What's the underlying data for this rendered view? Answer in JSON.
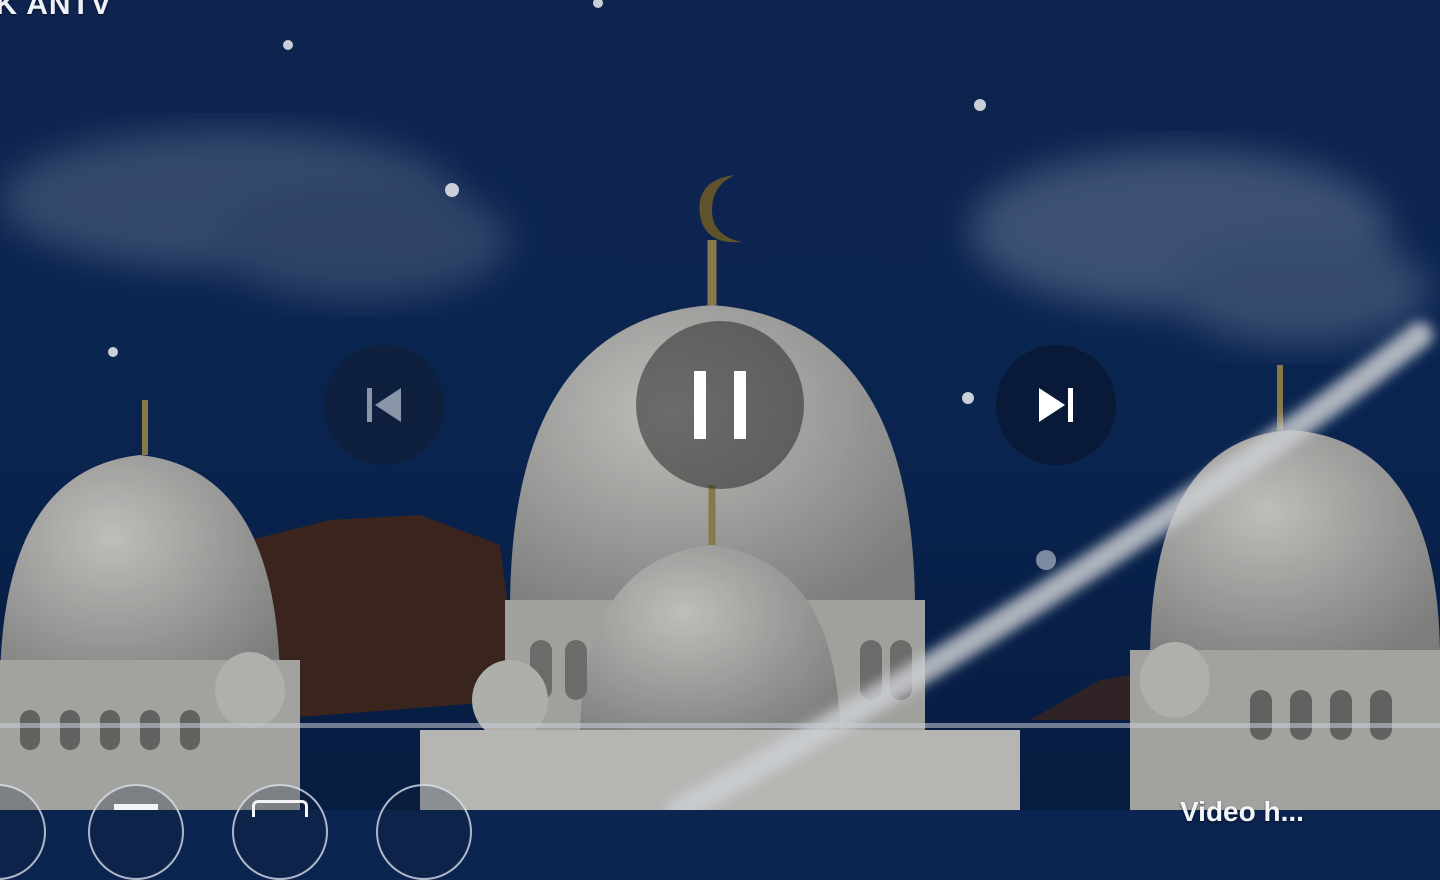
{
  "video": {
    "channel_watermark": "IK ANTV",
    "description": "Mosque domes with crescent finial under a starry night sky"
  },
  "controls": {
    "previous": "skip-previous-icon",
    "play_pause": "pause-icon",
    "next": "skip-next-icon"
  },
  "seek_bar": {
    "progress": 0.0
  },
  "bottom_bar": {
    "label_partial": "Video h..."
  },
  "colors": {
    "sky": "#0b2450",
    "control_bg": "#1e2a3c",
    "icon": "#ffffff"
  }
}
